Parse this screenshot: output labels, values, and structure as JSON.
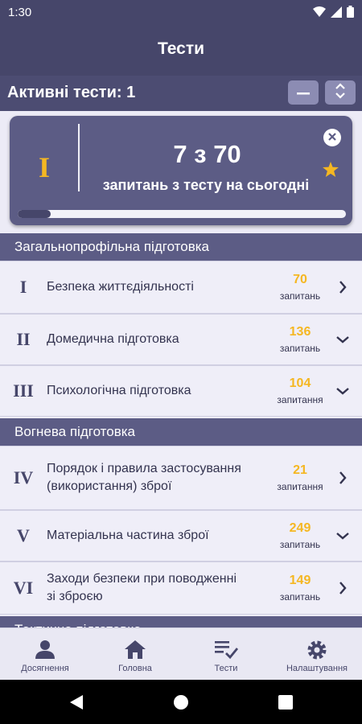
{
  "status_bar": {
    "time": "1:30"
  },
  "app_bar": {
    "title": "Тести"
  },
  "active_tests": {
    "label": "Активні тести: 1"
  },
  "daily_card": {
    "roman": "I",
    "count_text": "7 з 70",
    "subtitle": "запитань з тесту на сьогодні",
    "progress": 0.1
  },
  "sections": [
    {
      "title": "Загальнопрофільна підготовка",
      "items": [
        {
          "num": "I",
          "name": "Безпека життєдіяльності",
          "count": "70",
          "unit": "запитань",
          "chevron": "chevron-right-icon"
        },
        {
          "num": "II",
          "name": "Домедична підготовка",
          "count": "136",
          "unit": "запитань",
          "chevron": "chevron-down-icon"
        },
        {
          "num": "III",
          "name": "Психологічна підготовка",
          "count": "104",
          "unit": "запитання",
          "chevron": "chevron-down-icon"
        }
      ]
    },
    {
      "title": "Вогнева підготовка",
      "items": [
        {
          "num": "IV",
          "name": "Порядок і правила застосування (використання) зброї",
          "count": "21",
          "unit": "запитання",
          "chevron": "chevron-right-icon"
        },
        {
          "num": "V",
          "name": "Матеріальна частина зброї",
          "count": "249",
          "unit": "запитань",
          "chevron": "chevron-down-icon"
        },
        {
          "num": "VI",
          "name": "Заходи безпеки при поводженні зі зброєю",
          "count": "149",
          "unit": "запитань",
          "chevron": "chevron-right-icon"
        }
      ]
    },
    {
      "title": "Тактична підготовка",
      "items": []
    }
  ],
  "bottom_nav": [
    {
      "label": "Досягнення",
      "icon": "person-icon"
    },
    {
      "label": "Головна",
      "icon": "home-icon"
    },
    {
      "label": "Тести",
      "icon": "checklist-icon"
    },
    {
      "label": "Налаштування",
      "icon": "gear-icon"
    }
  ],
  "colors": {
    "primary": "#46466a",
    "section": "#5c5c85",
    "accent": "#f5b722",
    "background": "#ecebf6"
  }
}
